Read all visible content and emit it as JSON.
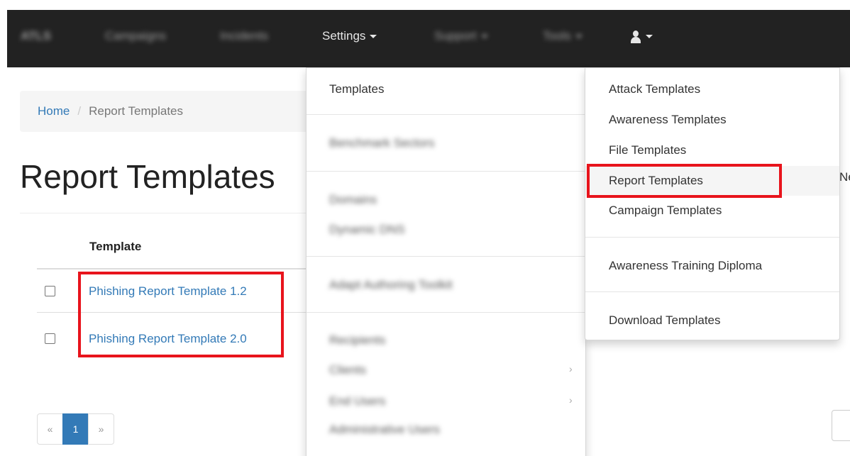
{
  "navbar": {
    "brand": "ATLS",
    "items": [
      "Campaigns",
      "Incidents"
    ],
    "settings_label": "Settings",
    "support_label": "Support",
    "tools_label": "Tools"
  },
  "breadcrumb": {
    "home": "Home",
    "separator": "/",
    "current": "Report Templates"
  },
  "page": {
    "title": "Report Templates"
  },
  "table": {
    "header_template": "Template",
    "rows": [
      {
        "name": "Phishing Report Template 1.2"
      },
      {
        "name": "Phishing Report Template 2.0"
      }
    ]
  },
  "pagination": {
    "prev": "«",
    "current": "1",
    "next": "»"
  },
  "settings_menu": {
    "items": [
      "Templates",
      "Benchmark Sectors",
      "Domains",
      "Dynamic DNS",
      "Adapt Authoring Toolkit",
      "Recipients",
      "Clients",
      "End Users",
      "Administrative Users"
    ],
    "arrow": "›"
  },
  "templates_submenu": {
    "items": [
      "Attack Templates",
      "Awareness Templates",
      "File Templates",
      "Report Templates",
      "Campaign Templates",
      "Awareness Training Diploma",
      "Download Templates"
    ]
  },
  "peek_text": "Ne",
  "colors": {
    "highlight": "#e8141c",
    "link": "#337ab7",
    "navbar": "#222222"
  }
}
